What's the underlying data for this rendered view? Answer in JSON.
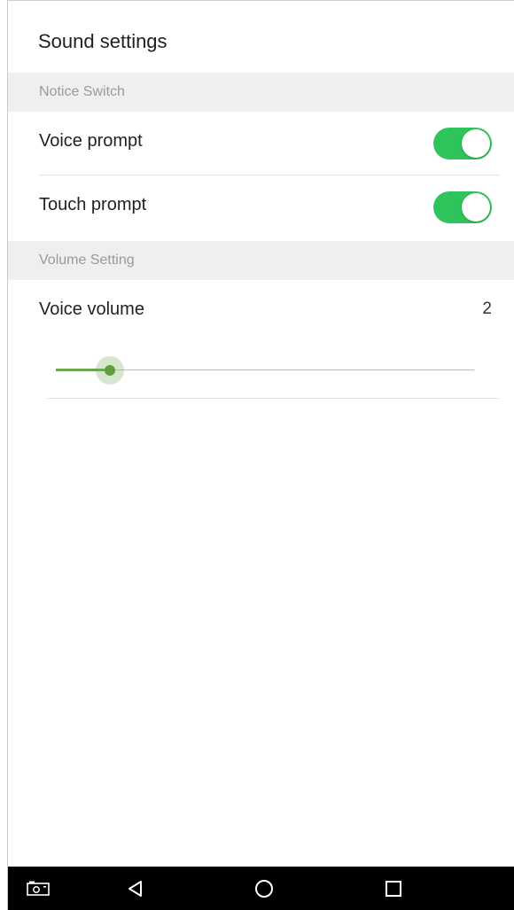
{
  "header": {
    "title": "Sound settings"
  },
  "sections": [
    {
      "title": "Notice Switch",
      "items": [
        {
          "label": "Voice prompt",
          "toggle_on": true
        },
        {
          "label": "Touch prompt",
          "toggle_on": true
        }
      ]
    },
    {
      "title": "Volume Setting",
      "items": [
        {
          "label": "Voice volume",
          "value": "2"
        }
      ]
    }
  ],
  "volume_slider": {
    "fraction": 0.13
  },
  "colors": {
    "toggle_on": "#2fc35b",
    "slider_accent": "#6aa84f",
    "section_bg": "#efefef",
    "nav_bar_bg": "#000000"
  },
  "nav_bar": {
    "icons": [
      "screenshot-icon",
      "back-icon",
      "home-icon",
      "recents-icon"
    ]
  }
}
